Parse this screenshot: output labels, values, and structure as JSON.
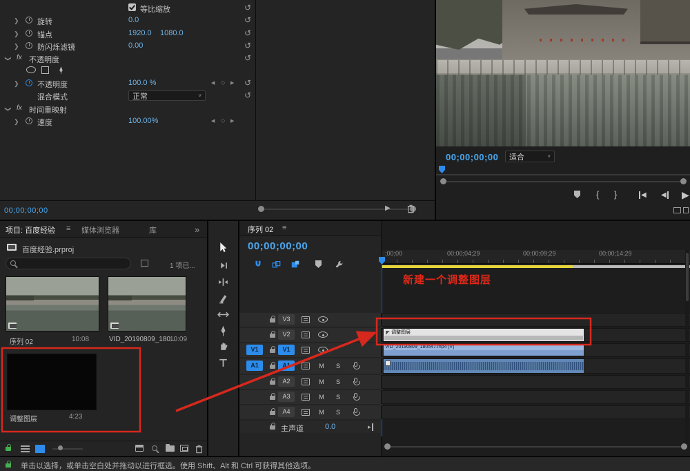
{
  "app": {
    "fx_badge": "fx"
  },
  "effect_controls": {
    "timecode": "00;00;00;00",
    "scale_check_label": "等比缩放",
    "rotation_label": "旋转",
    "rotation_value": "0.0",
    "anchor_label": "锚点",
    "anchor_x": "1920.0",
    "anchor_y": "1080.0",
    "antiflicker_label": "防闪烁滤镜",
    "antiflicker_value": "0.00",
    "opacity_section_label": "不透明度",
    "opacity_label": "不透明度",
    "opacity_value": "100.0 %",
    "blend_label": "混合模式",
    "blend_value": "正常",
    "time_remap_label": "时间重映射",
    "speed_label": "速度",
    "speed_value": "100.00%"
  },
  "program_monitor": {
    "timecode": "00;00;00;00",
    "fit_select": "适合"
  },
  "project_panel": {
    "tab_project": "项目: 百度经验",
    "tab_media": "媒体浏览器",
    "tab_libraries": "库",
    "overflow_chevrons": "»",
    "project_file": "百度经验.prproj",
    "selection_info": "1 项已...",
    "items": [
      {
        "name": "序列 02",
        "duration": "10:08"
      },
      {
        "name": "VID_20190809_180...",
        "duration": "10:09"
      },
      {
        "name": "调整图层",
        "duration": "4:23"
      }
    ]
  },
  "timeline": {
    "tab": "序列 02",
    "timecode": "00;00;00;00",
    "ruler_labels": [
      ";00;00",
      "00;00;04;29",
      "00;00;09;29",
      "00;00;14;29"
    ],
    "annotation": "新建一个调整图层",
    "tracks": {
      "v3": "V3",
      "v2": "V2",
      "v1": "V1",
      "a1": "A1",
      "a2": "A2",
      "a3": "A3",
      "a4": "A4",
      "source_v1": "V1",
      "source_a1": "A1",
      "mute": "M",
      "solo": "S",
      "master": "主声道",
      "master_value": "0.0"
    },
    "clips": {
      "adjustment": "调整图层",
      "video": "VID_20190809_180547.mp4 [V]"
    }
  },
  "status_bar": {
    "message": "单击以选择，或单击空白处并拖动以进行框选。使用 Shift、Alt 和 Ctrl 可获得其他选项。"
  }
}
